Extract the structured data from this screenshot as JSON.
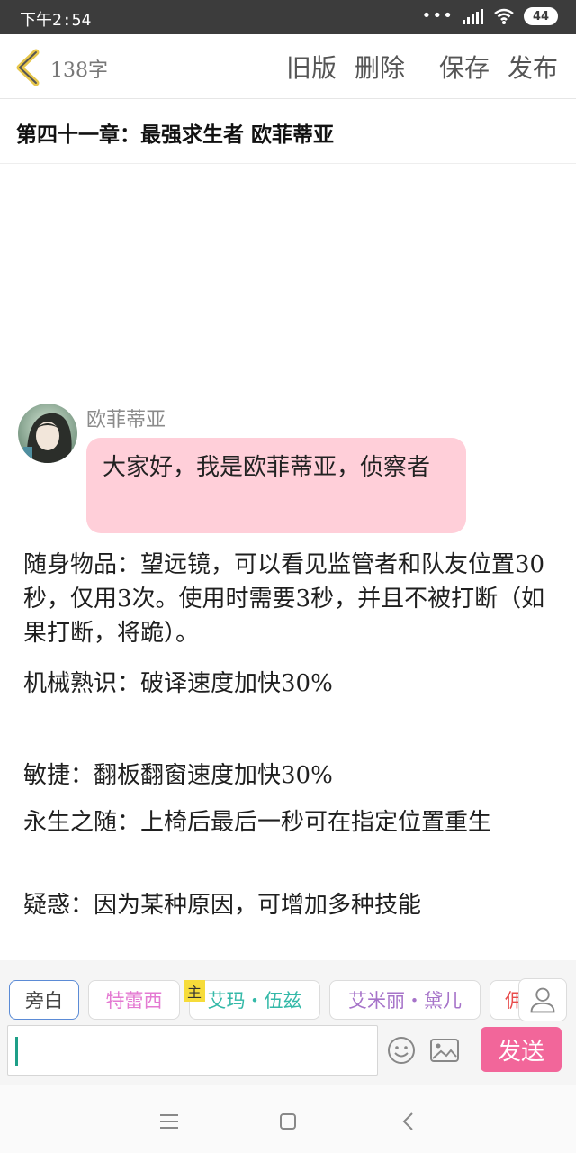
{
  "status_bar": {
    "time": "下午2:54",
    "battery": "44"
  },
  "toolbar": {
    "word_count": "138字",
    "old_version": "旧版",
    "delete": "删除",
    "save": "保存",
    "publish": "发布"
  },
  "chapter": {
    "title": "第四十一章：最强求生者 欧菲蒂亚"
  },
  "dialog": {
    "speaker": "欧菲蒂亚",
    "text": "大家好，我是欧菲蒂亚，侦察者"
  },
  "body": [
    "随身物品：望远镜，可以看见监管者和队友位置30秒，仅用3次。使用时需要3秒，并且不被打断（如果打断，将跪）。",
    "机械熟识：破译速度加快30%",
    "敏捷：翻板翻窗速度加快30%",
    "永生之随：上椅后最后一秒可在指定位置重生",
    "疑惑：因为某种原因，可增加多种技能"
  ],
  "characters": [
    "旁白",
    "特蕾西",
    "艾玛・伍兹",
    "艾米丽・黛儿",
    "佣"
  ],
  "main_badge": "主",
  "input": {
    "value": "",
    "placeholder": ""
  },
  "send_label": "发送",
  "colors": {
    "accent": "#f2669a",
    "bubble": "#ffcfd9",
    "caret": "#1e9f88"
  }
}
